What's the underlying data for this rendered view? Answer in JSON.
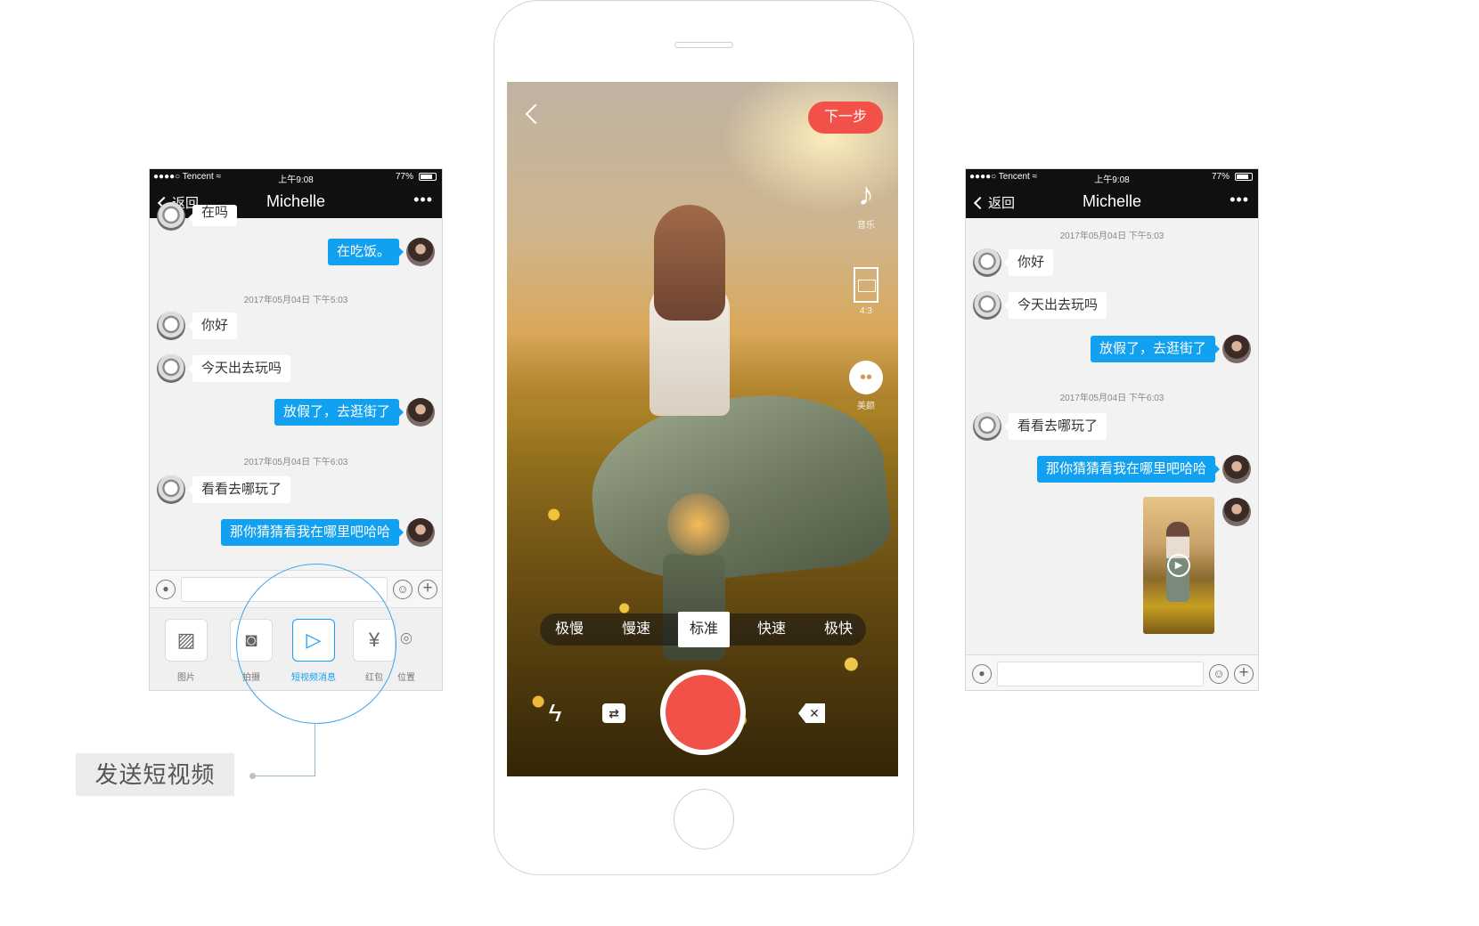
{
  "status": {
    "carrier": "●●●●○ Tencent ≈",
    "time": "上午9:08",
    "battery": "77%"
  },
  "nav": {
    "back": "返回",
    "title": "Michelle",
    "more": "•••"
  },
  "left": {
    "cut_top_text": "在吗",
    "messages_top": {
      "out1": "在吃饭。"
    },
    "timestamp1": "2017年05月04日 下午5:03",
    "in1": "你好",
    "in2": "今天出去玩吗",
    "out2": "放假了，去逛街了",
    "timestamp2": "2017年05月04日 下午6:03",
    "in3": "看看去哪玩了",
    "out3": "那你猜猜看我在哪里吧哈哈",
    "tools": [
      {
        "label": "图片",
        "icon": "picture-icon"
      },
      {
        "label": "拍摄",
        "icon": "camera-icon"
      },
      {
        "label": "短视频消息",
        "icon": "video-icon"
      },
      {
        "label": "红包",
        "icon": "red-packet-icon"
      },
      {
        "label": "位置",
        "icon": "location-icon"
      }
    ]
  },
  "callout": {
    "label": "发送短视频"
  },
  "camera": {
    "next": "下一步",
    "side_tools": [
      {
        "label": "音乐",
        "icon": "music-note-icon"
      },
      {
        "label": "4:3",
        "icon": "aspect-ratio-icon"
      },
      {
        "label": "美颜",
        "icon": "beauty-face-icon"
      }
    ],
    "speeds": [
      "极慢",
      "慢速",
      "标准",
      "快速",
      "极快"
    ],
    "selected_speed": "标准",
    "icons": {
      "flash": "flash-icon",
      "flip": "flip-camera-icon",
      "delete": "delete-icon",
      "record": "record-button"
    }
  },
  "right": {
    "timestamp1": "2017年05月04日 下午5:03",
    "in1": "你好",
    "in2": "今天出去玩吗",
    "out1": "放假了，去逛街了",
    "timestamp2": "2017年05月04日 下午6:03",
    "in3": "看看去哪玩了",
    "out2": "那你猜猜看我在哪里吧哈哈"
  },
  "colors": {
    "accent_blue": "#12a0f0",
    "record_red": "#f2514a",
    "bar_black": "#101010"
  }
}
